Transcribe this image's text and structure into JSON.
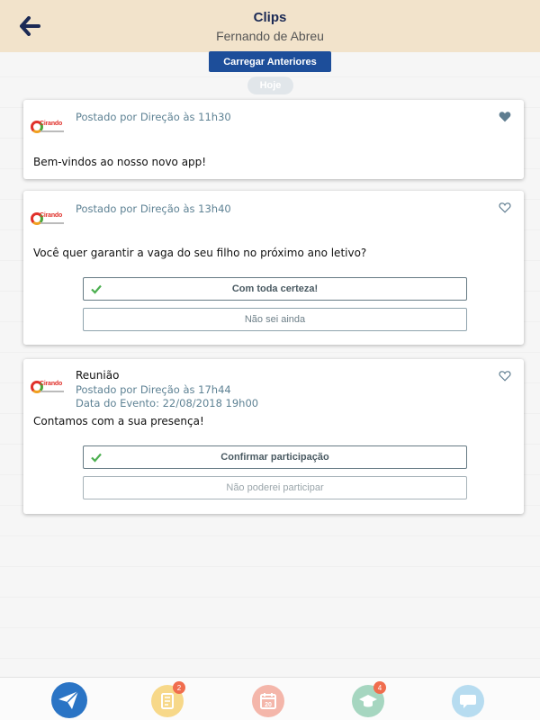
{
  "header": {
    "title": "Clips",
    "subtitle": "Fernando de Abreu"
  },
  "load_button": "Carregar Anteriores",
  "date_separator": "Hoje",
  "logo_text": "Cirando",
  "posts": [
    {
      "meta": "Postado por Direção às 11h30",
      "message": "Bem-vindos ao nosso novo app!",
      "liked": true
    },
    {
      "meta": "Postado por Direção às 13h40",
      "message": "Você quer garantir a vaga do seu filho no próximo ano letivo?",
      "liked": false,
      "options": [
        "Com toda certeza!",
        "Não sei ainda"
      ]
    },
    {
      "title": "Reunião",
      "meta": "Postado por Direção às 17h44",
      "event_date": "Data do Evento: 22/08/2018 19h00",
      "message": "Contamos com a sua presença!",
      "liked": false,
      "options": [
        "Confirmar participação",
        "Não poderei participar"
      ]
    }
  ],
  "tabbar": {
    "tabs": [
      {
        "icon": "paper-plane-icon",
        "color": "#2a74c5"
      },
      {
        "icon": "notebook-icon",
        "color": "#f7d889",
        "badge": "2"
      },
      {
        "icon": "calendar-icon",
        "color": "#f4b6aa",
        "day": "20"
      },
      {
        "icon": "graduation-cap-icon",
        "color": "#a6d6c0",
        "badge": "4"
      },
      {
        "icon": "chat-bubble-icon",
        "color": "#b7dcf0"
      }
    ]
  },
  "colors": {
    "header_bg": "#f2e3cb",
    "primary_button": "#1d4e9a",
    "header_title": "#1c2a55",
    "meta_text": "#5e8294",
    "badge": "#f06d4e"
  }
}
